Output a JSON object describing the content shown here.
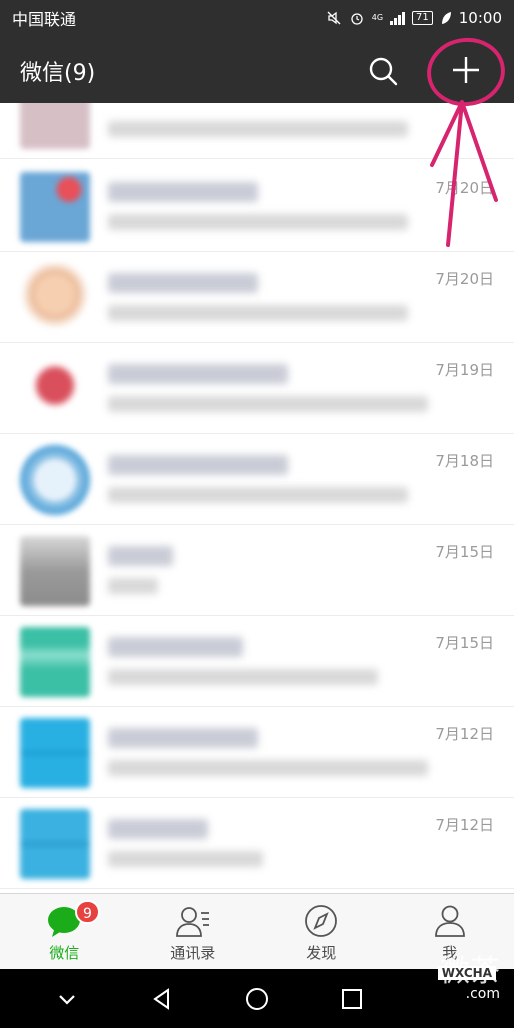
{
  "status_bar": {
    "carrier": "中国联通",
    "network": "4G",
    "battery": "71",
    "time": "10:00"
  },
  "header": {
    "title": "微信(9)",
    "icons": [
      "search-icon",
      "plus-icon"
    ]
  },
  "chats": [
    {
      "date": "7月20日",
      "avatar_color": "#6aa6d6"
    },
    {
      "date": "7月20日",
      "avatar_color": "#e9b48f"
    },
    {
      "date": "7月19日",
      "avatar_color": "#d94f5c"
    },
    {
      "date": "7月18日",
      "avatar_color": "#9cc9e8"
    },
    {
      "date": "7月15日",
      "avatar_color": "#9a9a9a"
    },
    {
      "date": "7月15日",
      "avatar_color": "#3bbfa5"
    },
    {
      "date": "7月12日",
      "avatar_color": "#29b0e3"
    },
    {
      "date": "7月12日",
      "avatar_color": "#3ab1e0"
    }
  ],
  "tabbar": {
    "tabs": [
      {
        "label": "微信",
        "icon": "chat-bubble-icon",
        "badge": "9",
        "active": true
      },
      {
        "label": "通讯录",
        "icon": "contacts-icon",
        "active": false
      },
      {
        "label": "发现",
        "icon": "compass-icon",
        "active": false
      },
      {
        "label": "我",
        "icon": "person-icon",
        "active": false
      }
    ]
  },
  "watermark": {
    "text": "微茶",
    "tag": "WXCHA",
    "domain": ".com"
  },
  "colors": {
    "header_bg": "#2f2f2f",
    "accent_green": "#1aad19",
    "badge_red": "#e64340",
    "annotation": "#d6246e"
  }
}
